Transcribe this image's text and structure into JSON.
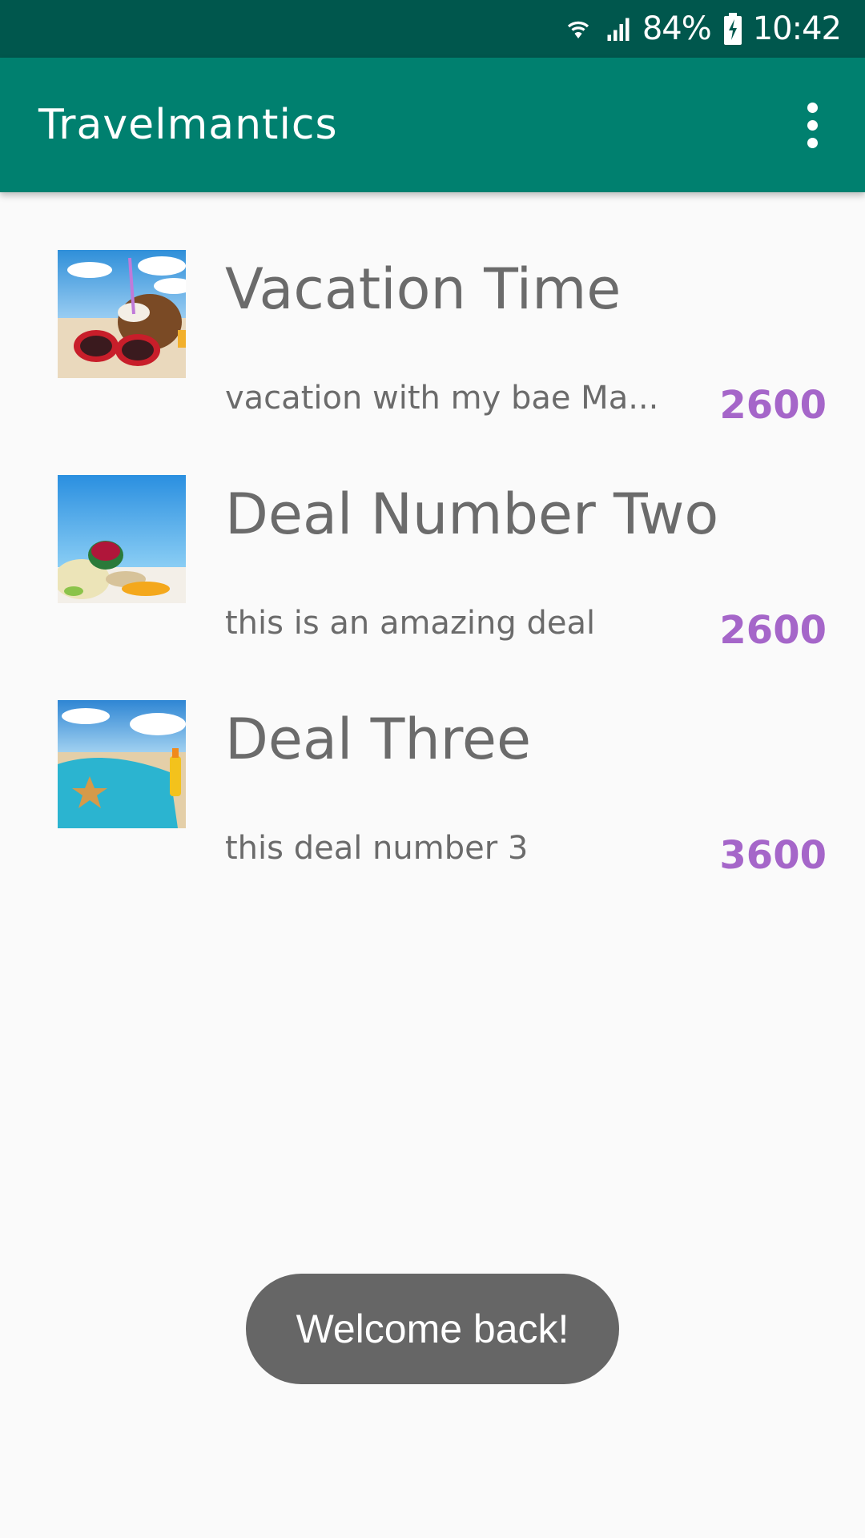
{
  "status_bar": {
    "battery_percent": "84%",
    "time": "10:42",
    "icons": [
      "wifi-icon",
      "signal-icon",
      "battery-charging-icon"
    ]
  },
  "app_bar": {
    "title": "Travelmantics",
    "overflow_icon": "more-vert-icon"
  },
  "deals": [
    {
      "title": "Vacation Time",
      "description": "vacation with my bae Ma...",
      "price": "2600",
      "thumbnail": "coconut-sunglasses-beach-image"
    },
    {
      "title": "Deal Number Two",
      "description": "this is an amazing deal",
      "price": "2600",
      "thumbnail": "beach-hat-flipflops-image"
    },
    {
      "title": "Deal Three",
      "description": "this deal number 3",
      "price": "3600",
      "thumbnail": "beach-towel-starfish-image"
    }
  ],
  "toast": {
    "message": "Welcome back!"
  },
  "colors": {
    "status_bar": "#00574d",
    "app_bar": "#00806f",
    "price": "#a566c9",
    "text": "#6b6b6b",
    "toast": "#666666"
  }
}
